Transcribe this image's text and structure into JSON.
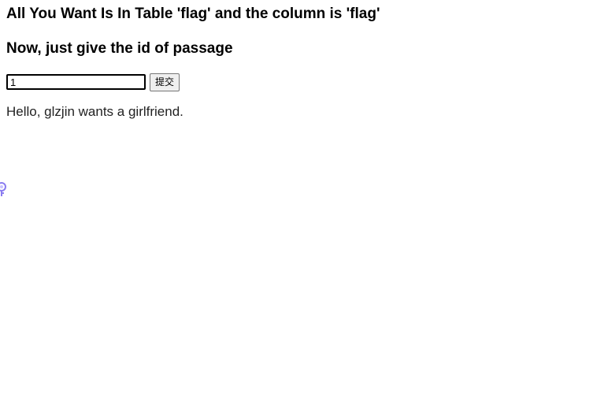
{
  "page": {
    "title": "All You Want Is In Table 'flag' and the column is 'flag'",
    "subtitle": "Now, just give the id of passage"
  },
  "form": {
    "id_value": "1",
    "submit_label": "提交"
  },
  "result": {
    "message": "Hello, glzjin wants a girlfriend."
  },
  "icons": {
    "floating_extension": "key-icon"
  },
  "colors": {
    "background": "#ffffff",
    "text": "#000000",
    "icon_accent": "#8a7cf0"
  }
}
